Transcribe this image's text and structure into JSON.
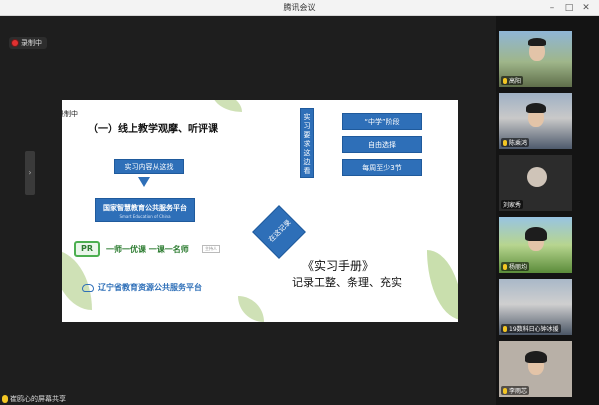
{
  "window": {
    "title": "腾讯会议"
  },
  "recording": {
    "label": "录制中"
  },
  "slide": {
    "recording_label": "录制中",
    "heading": "（一）线上教学观摩、听评课",
    "source_box": "实习内容从这找",
    "platform": {
      "line1": "国家智慧教育公共服务平台",
      "line2": "Smart Education of China"
    },
    "program": {
      "mark": "PR",
      "name": "一师一优课 一课一名师",
      "tag": "主持人"
    },
    "liaoning": "辽宁省教育资源公共服务平台",
    "vertical_box": "实习要求这边看",
    "right_boxes": [
      "“中学”阶段",
      "自由选择",
      "每周至少3节"
    ],
    "diamond": "在这记录",
    "manual_title": "《实习手册》",
    "manual_sub": "记录工整、条理、充实"
  },
  "screen_share": {
    "label": "崔鸥心的屏幕共享"
  },
  "participants": [
    {
      "name": "高阳"
    },
    {
      "name": "陈乘鸿"
    },
    {
      "name": "刘家秀"
    },
    {
      "name": "杨丽均"
    },
    {
      "name": "19数科日心钟冰援"
    },
    {
      "name": "李雨芯"
    }
  ],
  "colors": {
    "accent": "#2e6fb8",
    "record": "#e03131",
    "mic": "#f3c623"
  }
}
